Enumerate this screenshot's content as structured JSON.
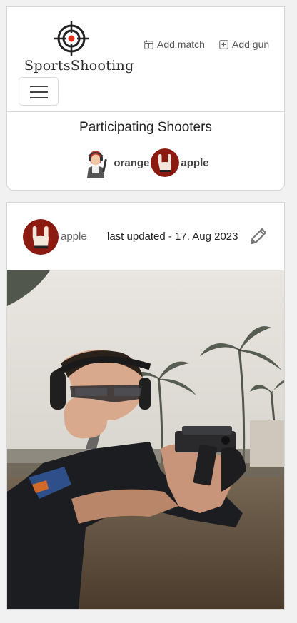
{
  "header": {
    "logo_text": "SportsShooting",
    "nav": {
      "add_match": "Add match",
      "add_gun": "Add gun"
    }
  },
  "participants_section": {
    "title": "Participating Shooters",
    "shooters": [
      {
        "name": "orange",
        "avatar": "woman-with-ear-protection-icon"
      },
      {
        "name": "apple",
        "avatar": "rock-hand-sign-icon"
      }
    ]
  },
  "post": {
    "user": "apple",
    "updated": "last updated - 17. Aug 2023",
    "edit_icon": "pencil-icon",
    "photo": "man-aiming-pistol-photo"
  },
  "colors": {
    "avatar_red": "#8b1a10",
    "target_red": "#e0301e"
  }
}
